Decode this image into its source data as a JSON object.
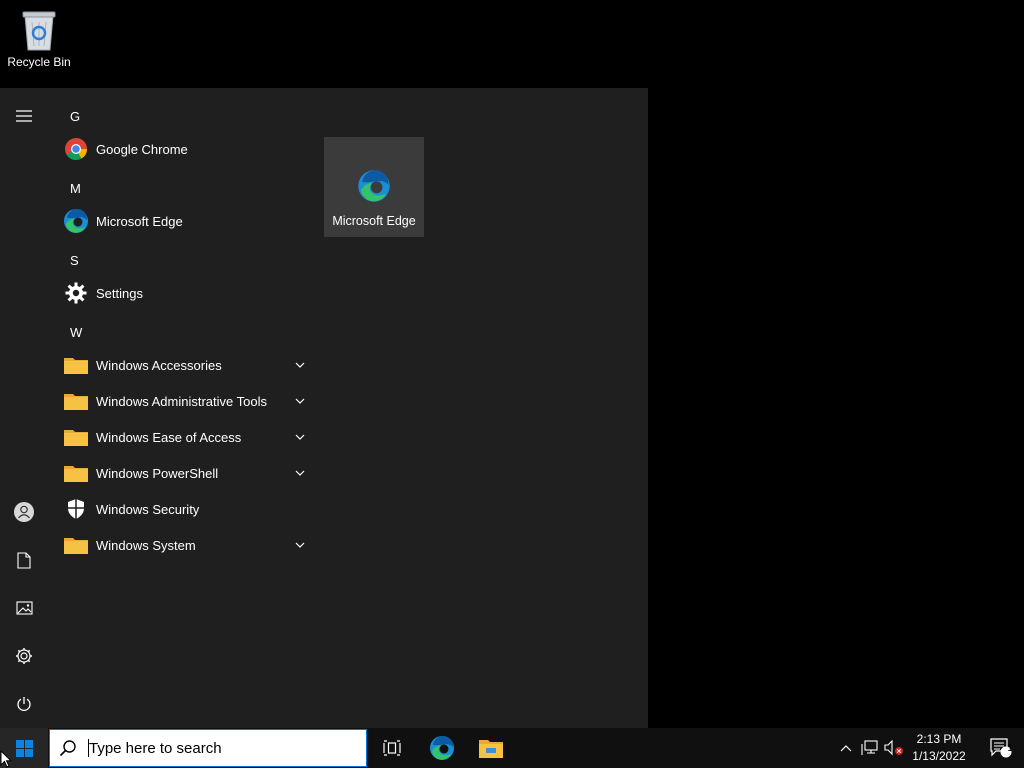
{
  "desktop": {
    "recycle_bin_label": "Recycle Bin"
  },
  "start_menu": {
    "letters": {
      "g": "G",
      "m": "M",
      "s": "S",
      "w": "W"
    },
    "apps": [
      {
        "name": "Google Chrome",
        "icon": "chrome-icon"
      },
      {
        "name": "Microsoft Edge",
        "icon": "edge-icon"
      },
      {
        "name": "Settings",
        "icon": "gear-icon"
      },
      {
        "name": "Windows Accessories",
        "icon": "folder-icon",
        "expandable": true
      },
      {
        "name": "Windows Administrative Tools",
        "icon": "folder-icon",
        "expandable": true
      },
      {
        "name": "Windows Ease of Access",
        "icon": "folder-icon",
        "expandable": true
      },
      {
        "name": "Windows PowerShell",
        "icon": "folder-icon",
        "expandable": true
      },
      {
        "name": "Windows Security",
        "icon": "shield-icon"
      },
      {
        "name": "Windows System",
        "icon": "folder-icon",
        "expandable": true
      }
    ],
    "tile": {
      "label": "Microsoft Edge",
      "icon": "edge-icon"
    },
    "rail_icons": [
      "hamburger-icon",
      "user-icon",
      "document-icon",
      "pictures-icon",
      "settings-icon",
      "power-icon"
    ]
  },
  "taskbar": {
    "search_placeholder": "Type here to search",
    "clock_time": "2:13 PM",
    "clock_date": "1/13/2022",
    "notification_count": "1"
  },
  "colors": {
    "accent": "#0078d7",
    "start_bg": "#1f1f1f",
    "tile_bg": "#3b3b3b",
    "folder": "#f6c244"
  }
}
